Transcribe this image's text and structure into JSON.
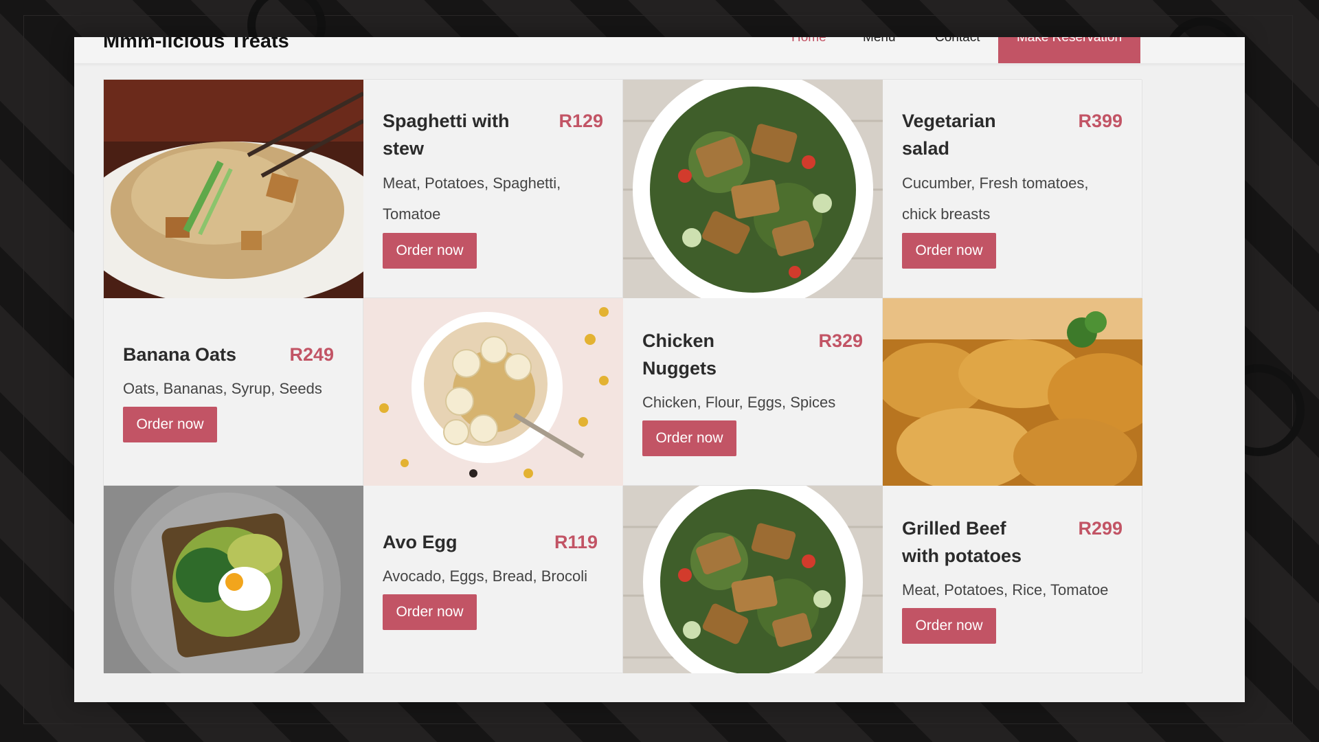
{
  "brand": "Mmm-licious Treats",
  "nav": {
    "home": "Home",
    "menu": "Menu",
    "contact": "Contact",
    "reservation": "Make Reservation"
  },
  "colors": {
    "accent": "#c25465",
    "page_bg": "#f0f0f0",
    "backdrop": "#1b1a1a"
  },
  "order_label": "Order now",
  "dishes": [
    {
      "title": "Spaghetti with stew",
      "price": "R129",
      "ingredients": "Meat, Potatoes, Spaghetti, Tomatoe",
      "photo": "noodle-stir-fry-photo"
    },
    {
      "title": "Vegetarian salad",
      "price": "R399",
      "ingredients": "Cucumber, Fresh tomatoes, chick breasts",
      "photo": "grilled-halloumi-salad-photo"
    },
    {
      "title": "Banana Oats",
      "price": "R249",
      "ingredients": "Oats, Bananas, Syrup, Seeds",
      "photo": "banana-oat-bowl-photo"
    },
    {
      "title": "Chicken Nuggets",
      "price": "R329",
      "ingredients": "Chicken, Flour, Eggs, Spices",
      "photo": "fried-chicken-photo"
    },
    {
      "title": "Avo Egg",
      "price": "R119",
      "ingredients": "Avocado, Eggs, Bread, Brocoli",
      "photo": "avocado-egg-toast-photo"
    },
    {
      "title": "Grilled Beef with potatoes",
      "price": "R299",
      "ingredients": "Meat, Potatoes, Rice, Tomatoe",
      "photo": "grilled-halloumi-salad-photo"
    }
  ]
}
